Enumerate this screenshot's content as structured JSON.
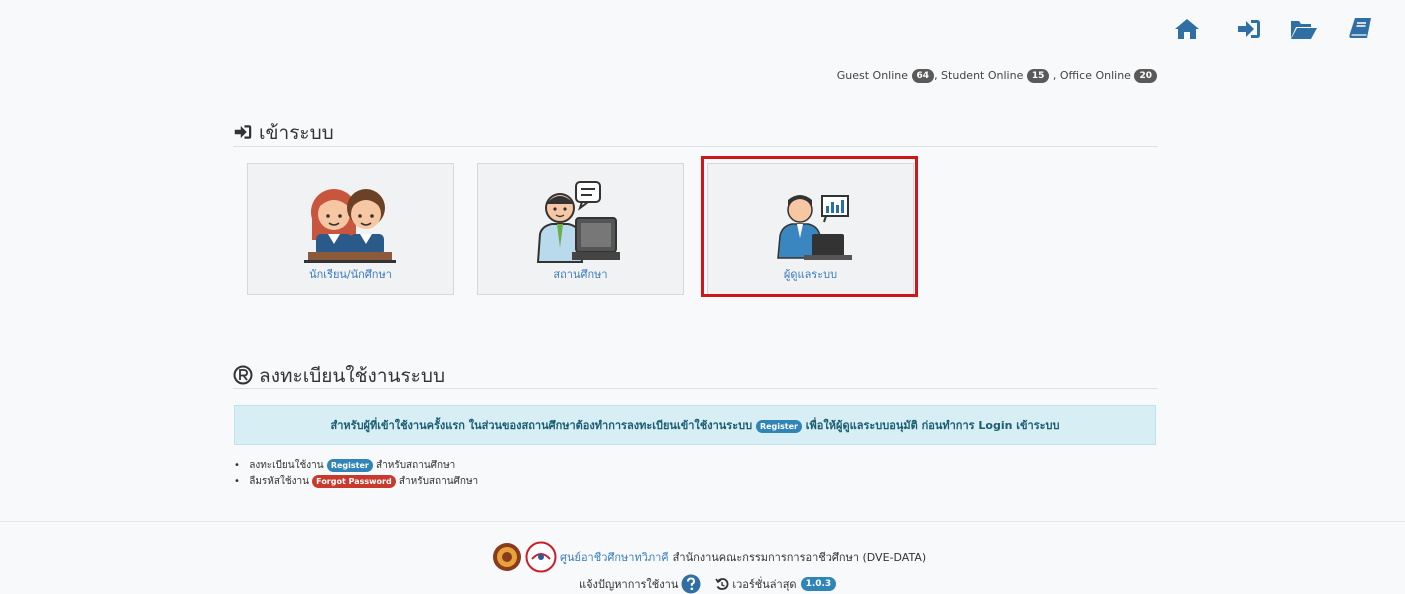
{
  "nav": {
    "icons": [
      "home-icon",
      "sign-in-icon",
      "folder-open-icon",
      "book-icon"
    ],
    "color": "#2f6fa3"
  },
  "online": {
    "guest_label": "Guest Online",
    "guest_count": "64",
    "student_label": ", Student Online",
    "student_count": "15",
    "office_label": ", Office Online",
    "office_count": "20"
  },
  "login": {
    "title": "เข้าระบบ",
    "cards": [
      {
        "label": "นักเรียน/นักศึกษา"
      },
      {
        "label": "สถานศึกษา"
      },
      {
        "label": "ผู้ดูแลระบบ"
      }
    ]
  },
  "register": {
    "title": "ลงทะเบียนใช้งานระบบ",
    "info_before": "สำหรับผู้ที่เข้าใช้งานครั้งแรก ในส่วนของสถานศึกษาต้องทำการลงทะเบียนเข้าใช้งานระบบ",
    "info_badge": "Register",
    "info_after": "เพื่อให้ผู้ดูแลระบบอนุมัติ ก่อนทำการ Login เข้าระบบ",
    "links": [
      {
        "before": "ลงทะเบียนใช้งาน",
        "badge": "Register",
        "after": "สำหรับสถานศึกษา"
      },
      {
        "before": "ลืมรหัสใช้งาน",
        "badge": "Forgot Password",
        "after": "สำหรับสถานศึกษา"
      }
    ]
  },
  "footer": {
    "org_link": "ศูนย์อาชีวศึกษาทวิภาคี",
    "org_text": "สำนักงานคณะกรรมการการอาชีวศึกษา (DVE-DATA)",
    "report_label": "แจ้งปัญหาการใช้งาน",
    "version_label": "เวอร์ชั่นล่าสุด",
    "version": "1.0.3"
  }
}
